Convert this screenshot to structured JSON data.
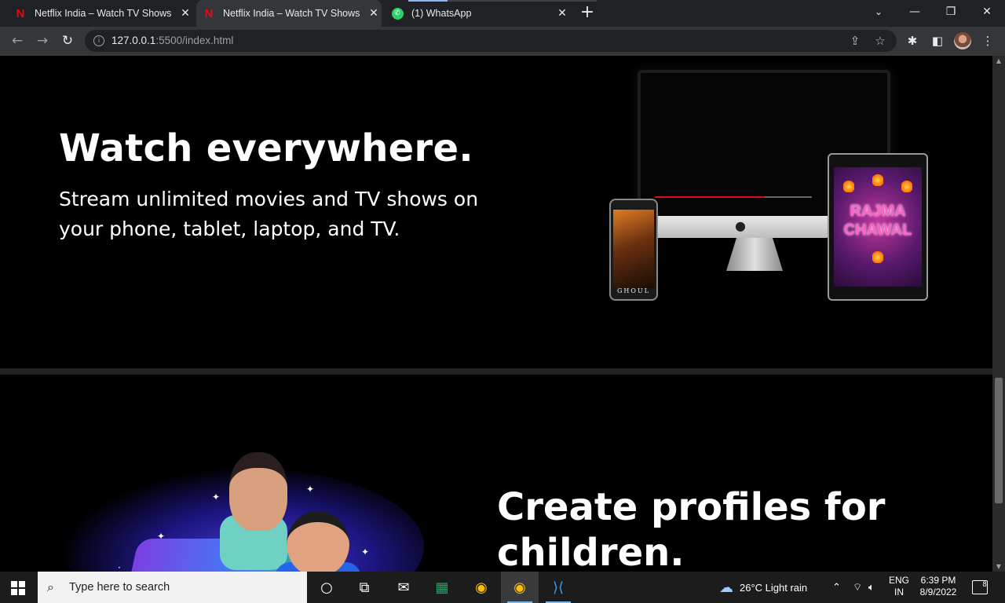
{
  "browser": {
    "tabs": [
      {
        "title": "Netflix India – Watch TV Shows Online",
        "icon": "netflix-icon",
        "active": false
      },
      {
        "title": "Netflix India – Watch TV Shows Online",
        "icon": "netflix-icon",
        "active": true
      },
      {
        "title": "(1) WhatsApp",
        "icon": "whatsapp-icon",
        "active": false
      }
    ],
    "new_tab_label": "+",
    "url_host": "127.0.0.1",
    "url_rest": ":5500/index.html"
  },
  "page": {
    "watch_heading": "Watch everywhere.",
    "watch_text": "Stream unlimited movies and TV shows on your phone, tablet, laptop, and TV.",
    "kids_heading": "Create profiles for children.",
    "phone_caption": "GHOUL",
    "tablet_title": "RAJMA CHAWAL"
  },
  "taskbar": {
    "search_placeholder": "Type here to search",
    "weather": "26°C  Light rain",
    "lang_top": "ENG",
    "lang_bottom": "IN",
    "time": "6:39 PM",
    "date": "8/9/2022",
    "notification_count": "8"
  },
  "colors": {
    "netflix_red": "#e50914",
    "background": "#000000",
    "chrome_dark": "#202124"
  }
}
